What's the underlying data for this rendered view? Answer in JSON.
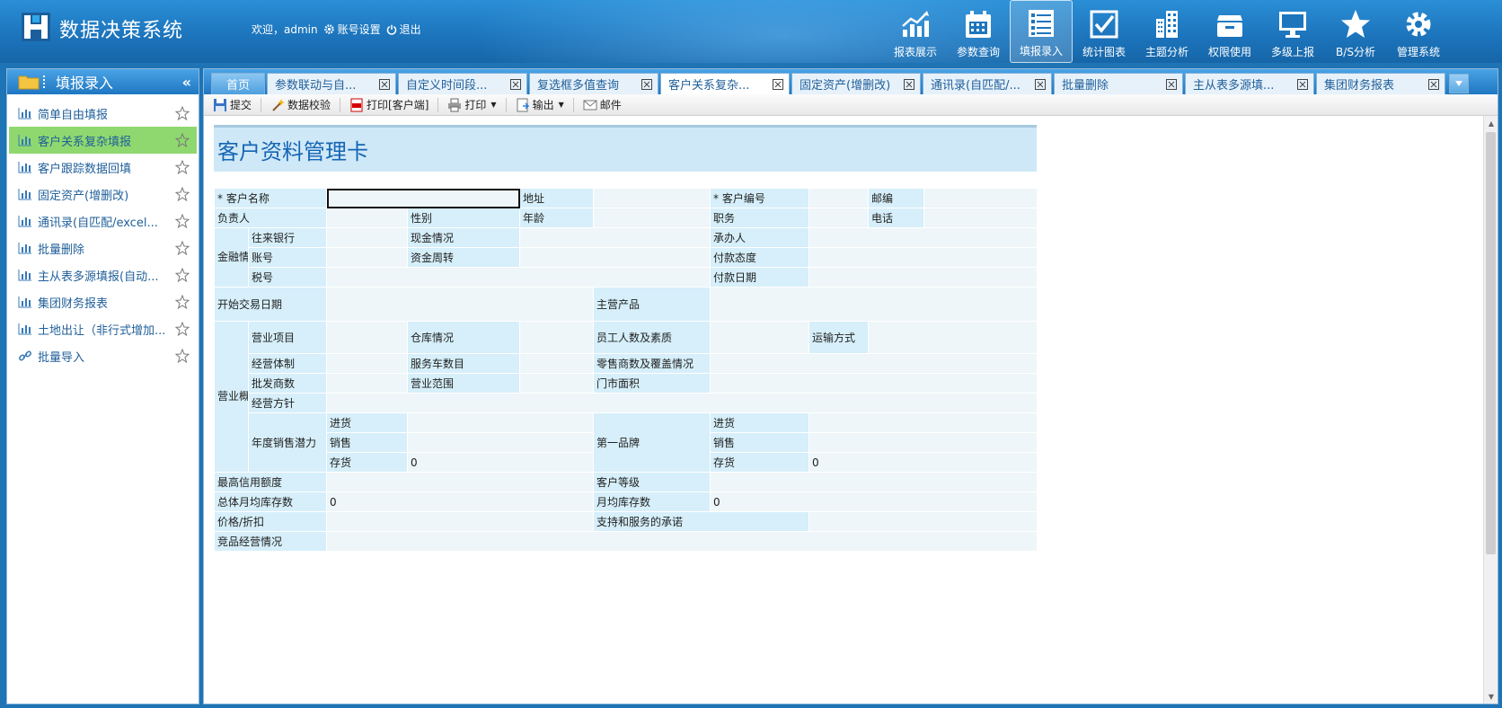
{
  "app": {
    "title": "数据决策系统"
  },
  "user": {
    "welcome": "欢迎，admin",
    "account_settings": "账号设置",
    "logout": "退出"
  },
  "topnav": [
    {
      "label": "报表展示",
      "icon": "chart-up-icon"
    },
    {
      "label": "参数查询",
      "icon": "calendar-icon"
    },
    {
      "label": "填报录入",
      "icon": "list-icon",
      "active": true
    },
    {
      "label": "统计图表",
      "icon": "check-chart-icon"
    },
    {
      "label": "主题分析",
      "icon": "building-icon"
    },
    {
      "label": "权限使用",
      "icon": "inbox-icon"
    },
    {
      "label": "多级上报",
      "icon": "monitor-icon"
    },
    {
      "label": "B/S分析",
      "icon": "star-icon"
    },
    {
      "label": "管理系统",
      "icon": "gear-icon"
    }
  ],
  "sidebar": {
    "title": "填报录入",
    "items": [
      {
        "label": "简单自由填报"
      },
      {
        "label": "客户关系复杂填报",
        "active": true
      },
      {
        "label": "客户跟踪数据回填"
      },
      {
        "label": "固定资产(增删改)"
      },
      {
        "label": "通讯录(自匹配/excel..."
      },
      {
        "label": "批量删除"
      },
      {
        "label": "主从表多源填报(自动..."
      },
      {
        "label": "集团财务报表"
      },
      {
        "label": "土地出让（非行式增加..."
      },
      {
        "label": "批量导入"
      }
    ]
  },
  "tabs": {
    "home": "首页",
    "items": [
      {
        "label": "参数联动与自..."
      },
      {
        "label": "自定义时间段..."
      },
      {
        "label": "复选框多值查询"
      },
      {
        "label": "客户关系复杂...",
        "active": true
      },
      {
        "label": "固定资产(增删改)"
      },
      {
        "label": "通讯录(自匹配/..."
      },
      {
        "label": "批量删除"
      },
      {
        "label": "主从表多源填..."
      },
      {
        "label": "集团财务报表"
      }
    ]
  },
  "toolbar": {
    "submit": "提交",
    "validate": "数据校验",
    "print_client": "打印[客户端]",
    "print": "打印",
    "export": "输出",
    "mail": "邮件"
  },
  "form": {
    "title": "客户资料管理卡",
    "labels": {
      "customer_name": "* 客户名称",
      "address": "地址",
      "customer_no": "* 客户编号",
      "postcode": "邮编",
      "manager": "负责人",
      "gender": "性别",
      "age": "年龄",
      "position": "职务",
      "phone": "电话",
      "finance": "金融情况",
      "bank": "往来银行",
      "cash": "现金情况",
      "handler": "承办人",
      "account": "账号",
      "turnover": "资金周转",
      "pay_attitude": "付款态度",
      "tax_no": "税号",
      "pay_date": "付款日期",
      "start_date": "开始交易日期",
      "main_product": "主营产品",
      "business": "营业概况",
      "biz_project": "营业项目",
      "warehouse": "仓库情况",
      "staff": "员工人数及素质",
      "transport": "运输方式",
      "biz_system": "经营体制",
      "service_cars": "服务车数目",
      "retail": "零售商数及覆盖情况",
      "wholesale": "批发商数",
      "biz_scope": "营业范围",
      "store_area": "门市面积",
      "biz_policy": "经营方针",
      "annual_potential": "年度销售潜力",
      "stock_in": "进货",
      "sales": "销售",
      "inventory": "存货",
      "first_brand": "第一品牌",
      "credit_limit": "最高信用额度",
      "customer_level": "客户等级",
      "total_monthly_stock": "总体月均库存数",
      "monthly_stock": "月均库存数",
      "price_discount": "价格/折扣",
      "support_promise": "支持和服务的承诺",
      "competitor": "竞品经营情况"
    },
    "values": {
      "annual_inventory": "0",
      "brand_inventory": "0",
      "total_monthly_stock": "0",
      "monthly_stock": "0"
    }
  }
}
